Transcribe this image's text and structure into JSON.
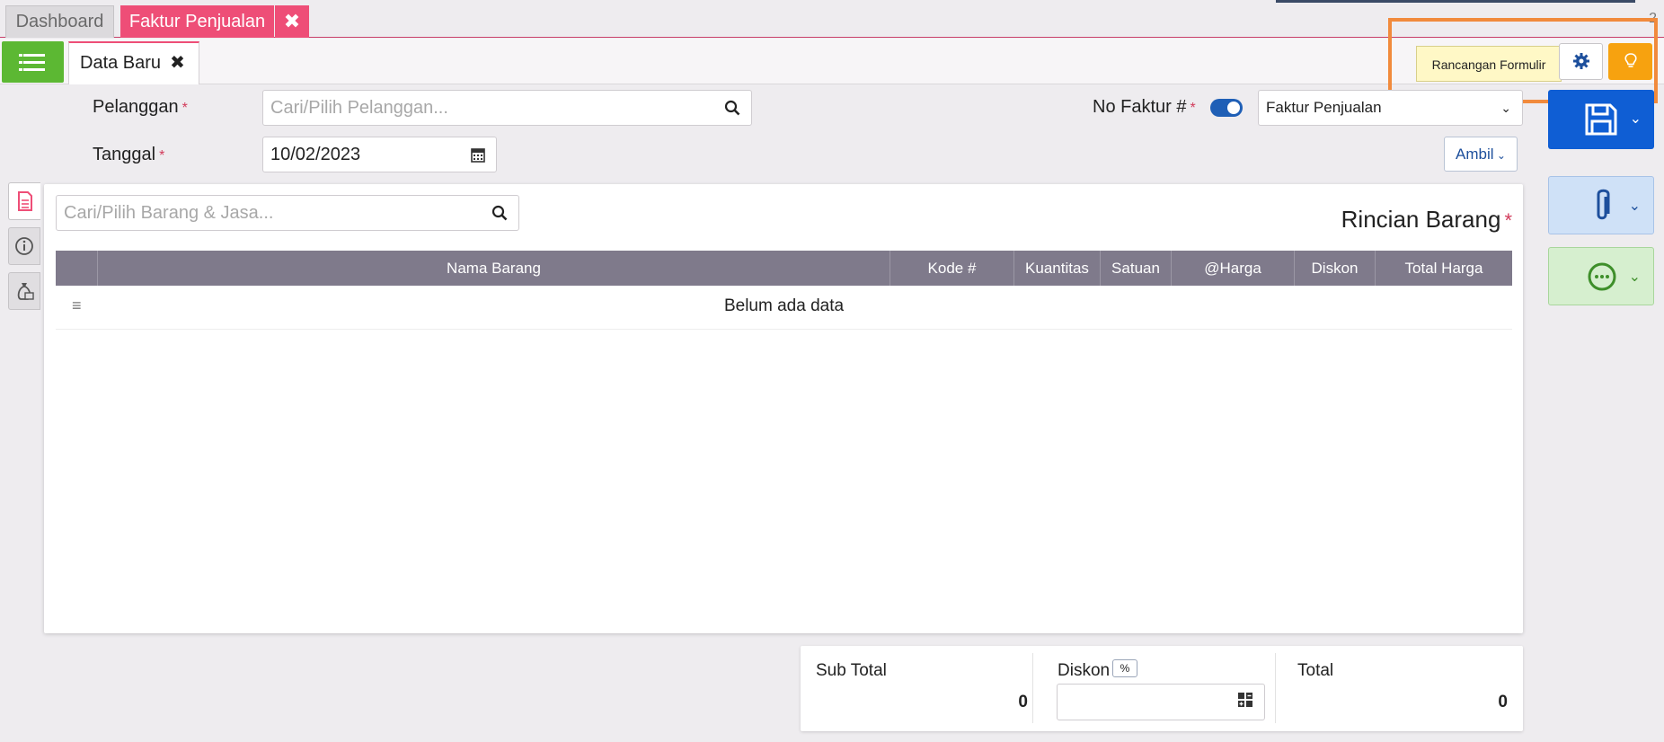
{
  "tabs": {
    "dashboard": "Dashboard",
    "active": "Faktur Penjualan",
    "close": "✖",
    "count": "2"
  },
  "subtab": {
    "label": "Data Baru",
    "close": "✖"
  },
  "toolbar": {
    "tooltip": "Rancangan Formulir"
  },
  "form": {
    "pelanggan_label": "Pelanggan",
    "pelanggan_placeholder": "Cari/Pilih Pelanggan...",
    "tanggal_label": "Tanggal",
    "tanggal_value": "10/02/2023",
    "nofaktur_label": "No Faktur #",
    "faktur_type": "Faktur Penjualan",
    "required_mark": "*",
    "ambil_label": "Ambil"
  },
  "items": {
    "search_placeholder": "Cari/Pilih Barang & Jasa...",
    "title": "Rincian Barang",
    "columns": [
      "Nama Barang",
      "Kode #",
      "Kuantitas",
      "Satuan",
      "@Harga",
      "Diskon",
      "Total Harga"
    ],
    "empty_text": "Belum ada data"
  },
  "totals": {
    "subtotal_label": "Sub Total",
    "subtotal_value": "0",
    "diskon_label": "Diskon",
    "diskon_pct": "%",
    "total_label": "Total",
    "total_value": "0"
  },
  "colors": {
    "accent_pink": "#ee4e77",
    "menu_green": "#5cb833",
    "save_blue": "#0f5ed4",
    "table_header": "#7f7a8b",
    "highlight_orange": "#f18a3c"
  }
}
